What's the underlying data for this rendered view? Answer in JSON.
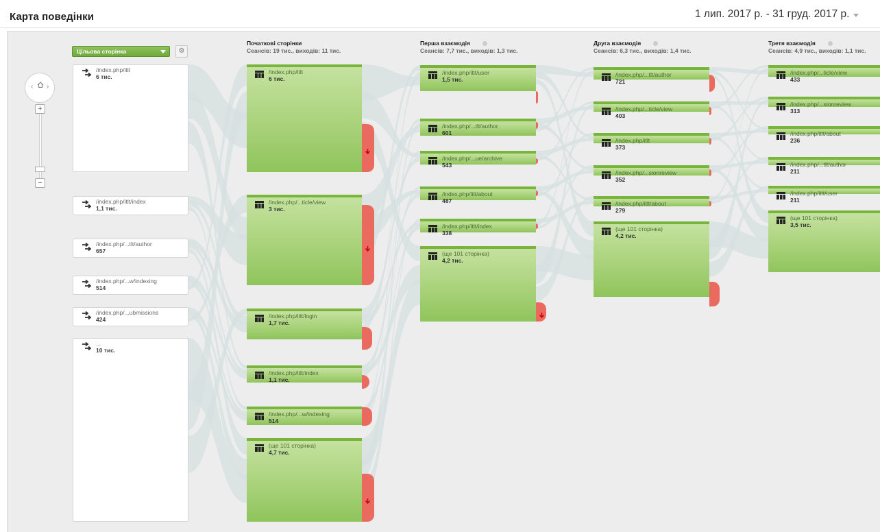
{
  "header": {
    "title": "Карта поведінки",
    "date_range": "1 лип. 2017 р. - 31 груд. 2017 р."
  },
  "dimension": {
    "selected": "Цільова сторінка"
  },
  "columns": [
    {
      "title": "Початкові сторінки",
      "stats": "Сеансів: 19 тис., виходів: 11 тис."
    },
    {
      "title": "Перша взаємодія",
      "stats": "Сеансів: 7,7 тис., виходів: 1,3 тис."
    },
    {
      "title": "Друга взаємодія",
      "stats": "Сеансів: 6,3 тис., виходів: 1,4 тис."
    },
    {
      "title": "Третя взаємодія",
      "stats": "Сеансів: 4,9 тис., виходів: 1,1 тис."
    }
  ],
  "sources": [
    {
      "path": "/index.php/itlt",
      "count": "6 тис."
    },
    {
      "path": "/index.php/itlt/index",
      "count": "1,1 тис."
    },
    {
      "path": "/index.php/...tlt/author",
      "count": "657"
    },
    {
      "path": "/index.php/...w/indexing",
      "count": "514"
    },
    {
      "path": "/index.php/...ubmissions",
      "count": "424"
    },
    {
      "path": "...",
      "count": "10 тис."
    }
  ],
  "starting_pages": [
    {
      "path": "/index.php/itlt",
      "count": "6 тис."
    },
    {
      "path": "/index.php/...ticle/view",
      "count": "3 тис."
    },
    {
      "path": "/index.php/itlt/login",
      "count": "1,7 тис."
    },
    {
      "path": "/index.php/itlt/index",
      "count": "1,1 тис."
    },
    {
      "path": "/index.php/...w/indexing",
      "count": "514"
    },
    {
      "path": "(ще 101 сторінка)",
      "count": "4,7 тис."
    }
  ],
  "first_interaction": [
    {
      "path": "/index.php/itlt/user",
      "count": "1,5 тис."
    },
    {
      "path": "/index.php/...tlt/author",
      "count": "601"
    },
    {
      "path": "/index.php/...ue/archive",
      "count": "543"
    },
    {
      "path": "/index.php/itlt/about",
      "count": "487"
    },
    {
      "path": "/index.php/itlt/index",
      "count": "338"
    },
    {
      "path": "(ще 101 сторінка)",
      "count": "4,2 тис."
    }
  ],
  "second_interaction": [
    {
      "path": "/index.php/...tlt/author",
      "count": "721"
    },
    {
      "path": "/index.php/...ticle/view",
      "count": "403"
    },
    {
      "path": "/index.php/itlt",
      "count": "373"
    },
    {
      "path": "/index.php/...sionreview",
      "count": "352"
    },
    {
      "path": "/index.php/itlt/about",
      "count": "279"
    },
    {
      "path": "(ще 101 сторінка)",
      "count": "4,2 тис."
    }
  ],
  "third_interaction": [
    {
      "path": "/index.php/...ticle/view",
      "count": "433"
    },
    {
      "path": "/index.php/...sionreview",
      "count": "313"
    },
    {
      "path": "/index.php/itlt/about",
      "count": "236"
    },
    {
      "path": "/index.php/...tlt/author",
      "count": "211"
    },
    {
      "path": "/index.php/itlt/user",
      "count": "211"
    },
    {
      "path": "(ще 101 сторінка)",
      "count": "3,5 тис."
    }
  ],
  "colors": {
    "node_green": "#a9d27a",
    "node_border": "#79b53c",
    "exit_red": "#ea6a60",
    "flow": "#d7e1e1"
  }
}
